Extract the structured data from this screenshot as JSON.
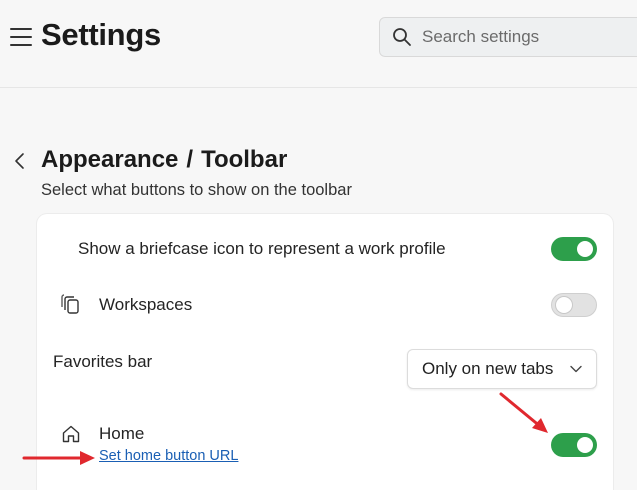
{
  "header": {
    "title": "Settings",
    "search_placeholder": "Search settings"
  },
  "breadcrumb": {
    "parent": "Appearance",
    "separator": "/",
    "current": "Toolbar"
  },
  "subtitle": "Select what buttons to show on the toolbar",
  "settings": {
    "work_profile": {
      "label": "Show a briefcase icon to represent a work profile",
      "enabled": true
    },
    "workspaces": {
      "label": "Workspaces",
      "icon": "workspaces-icon",
      "enabled": false
    },
    "favorites_bar": {
      "label": "Favorites bar",
      "selected": "Only on new tabs"
    },
    "home": {
      "label": "Home",
      "icon": "home-icon",
      "enabled": true,
      "link": "Set home button URL"
    }
  },
  "colors": {
    "toggle_on": "#2d9f4b",
    "link": "#1a5fb4",
    "annotation_arrow": "#e0282e"
  }
}
